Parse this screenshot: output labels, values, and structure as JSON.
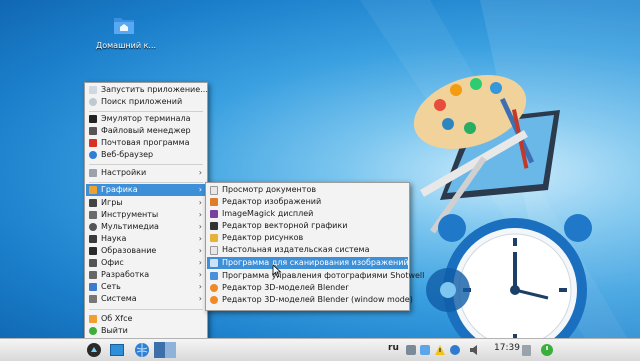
{
  "desktop": {
    "home_icon_label": "Домашний к..."
  },
  "main_menu": {
    "items": [
      {
        "label": "Запустить приложение..."
      },
      {
        "label": "Поиск приложений"
      },
      {
        "label": "Эмулятор терминала"
      },
      {
        "label": "Файловый менеджер"
      },
      {
        "label": "Почтовая программа"
      },
      {
        "label": "Веб-браузер"
      },
      {
        "label": "Настройки"
      },
      {
        "label": "Графика"
      },
      {
        "label": "Игры"
      },
      {
        "label": "Инструменты"
      },
      {
        "label": "Мультимедиа"
      },
      {
        "label": "Наука"
      },
      {
        "label": "Образование"
      },
      {
        "label": "Офис"
      },
      {
        "label": "Разработка"
      },
      {
        "label": "Сеть"
      },
      {
        "label": "Система"
      },
      {
        "label": "Об Xfce"
      },
      {
        "label": "Выйти"
      }
    ]
  },
  "submenu": {
    "items": [
      {
        "label": "Просмотр документов"
      },
      {
        "label": "Редактор изображений"
      },
      {
        "label": "ImageMagick дисплей"
      },
      {
        "label": "Редактор векторной графики"
      },
      {
        "label": "Редактор рисунков"
      },
      {
        "label": "Настольная издательская система"
      },
      {
        "label": "Программа для сканирования изображений"
      },
      {
        "label": "Программа управления фотографиями Shotwell"
      },
      {
        "label": "Редактор 3D-моделей Blender"
      },
      {
        "label": "Редактор 3D-моделей Blender (window mode)"
      }
    ]
  },
  "taskbar": {
    "keyboard_layout": "ru",
    "clock": "17:39"
  }
}
